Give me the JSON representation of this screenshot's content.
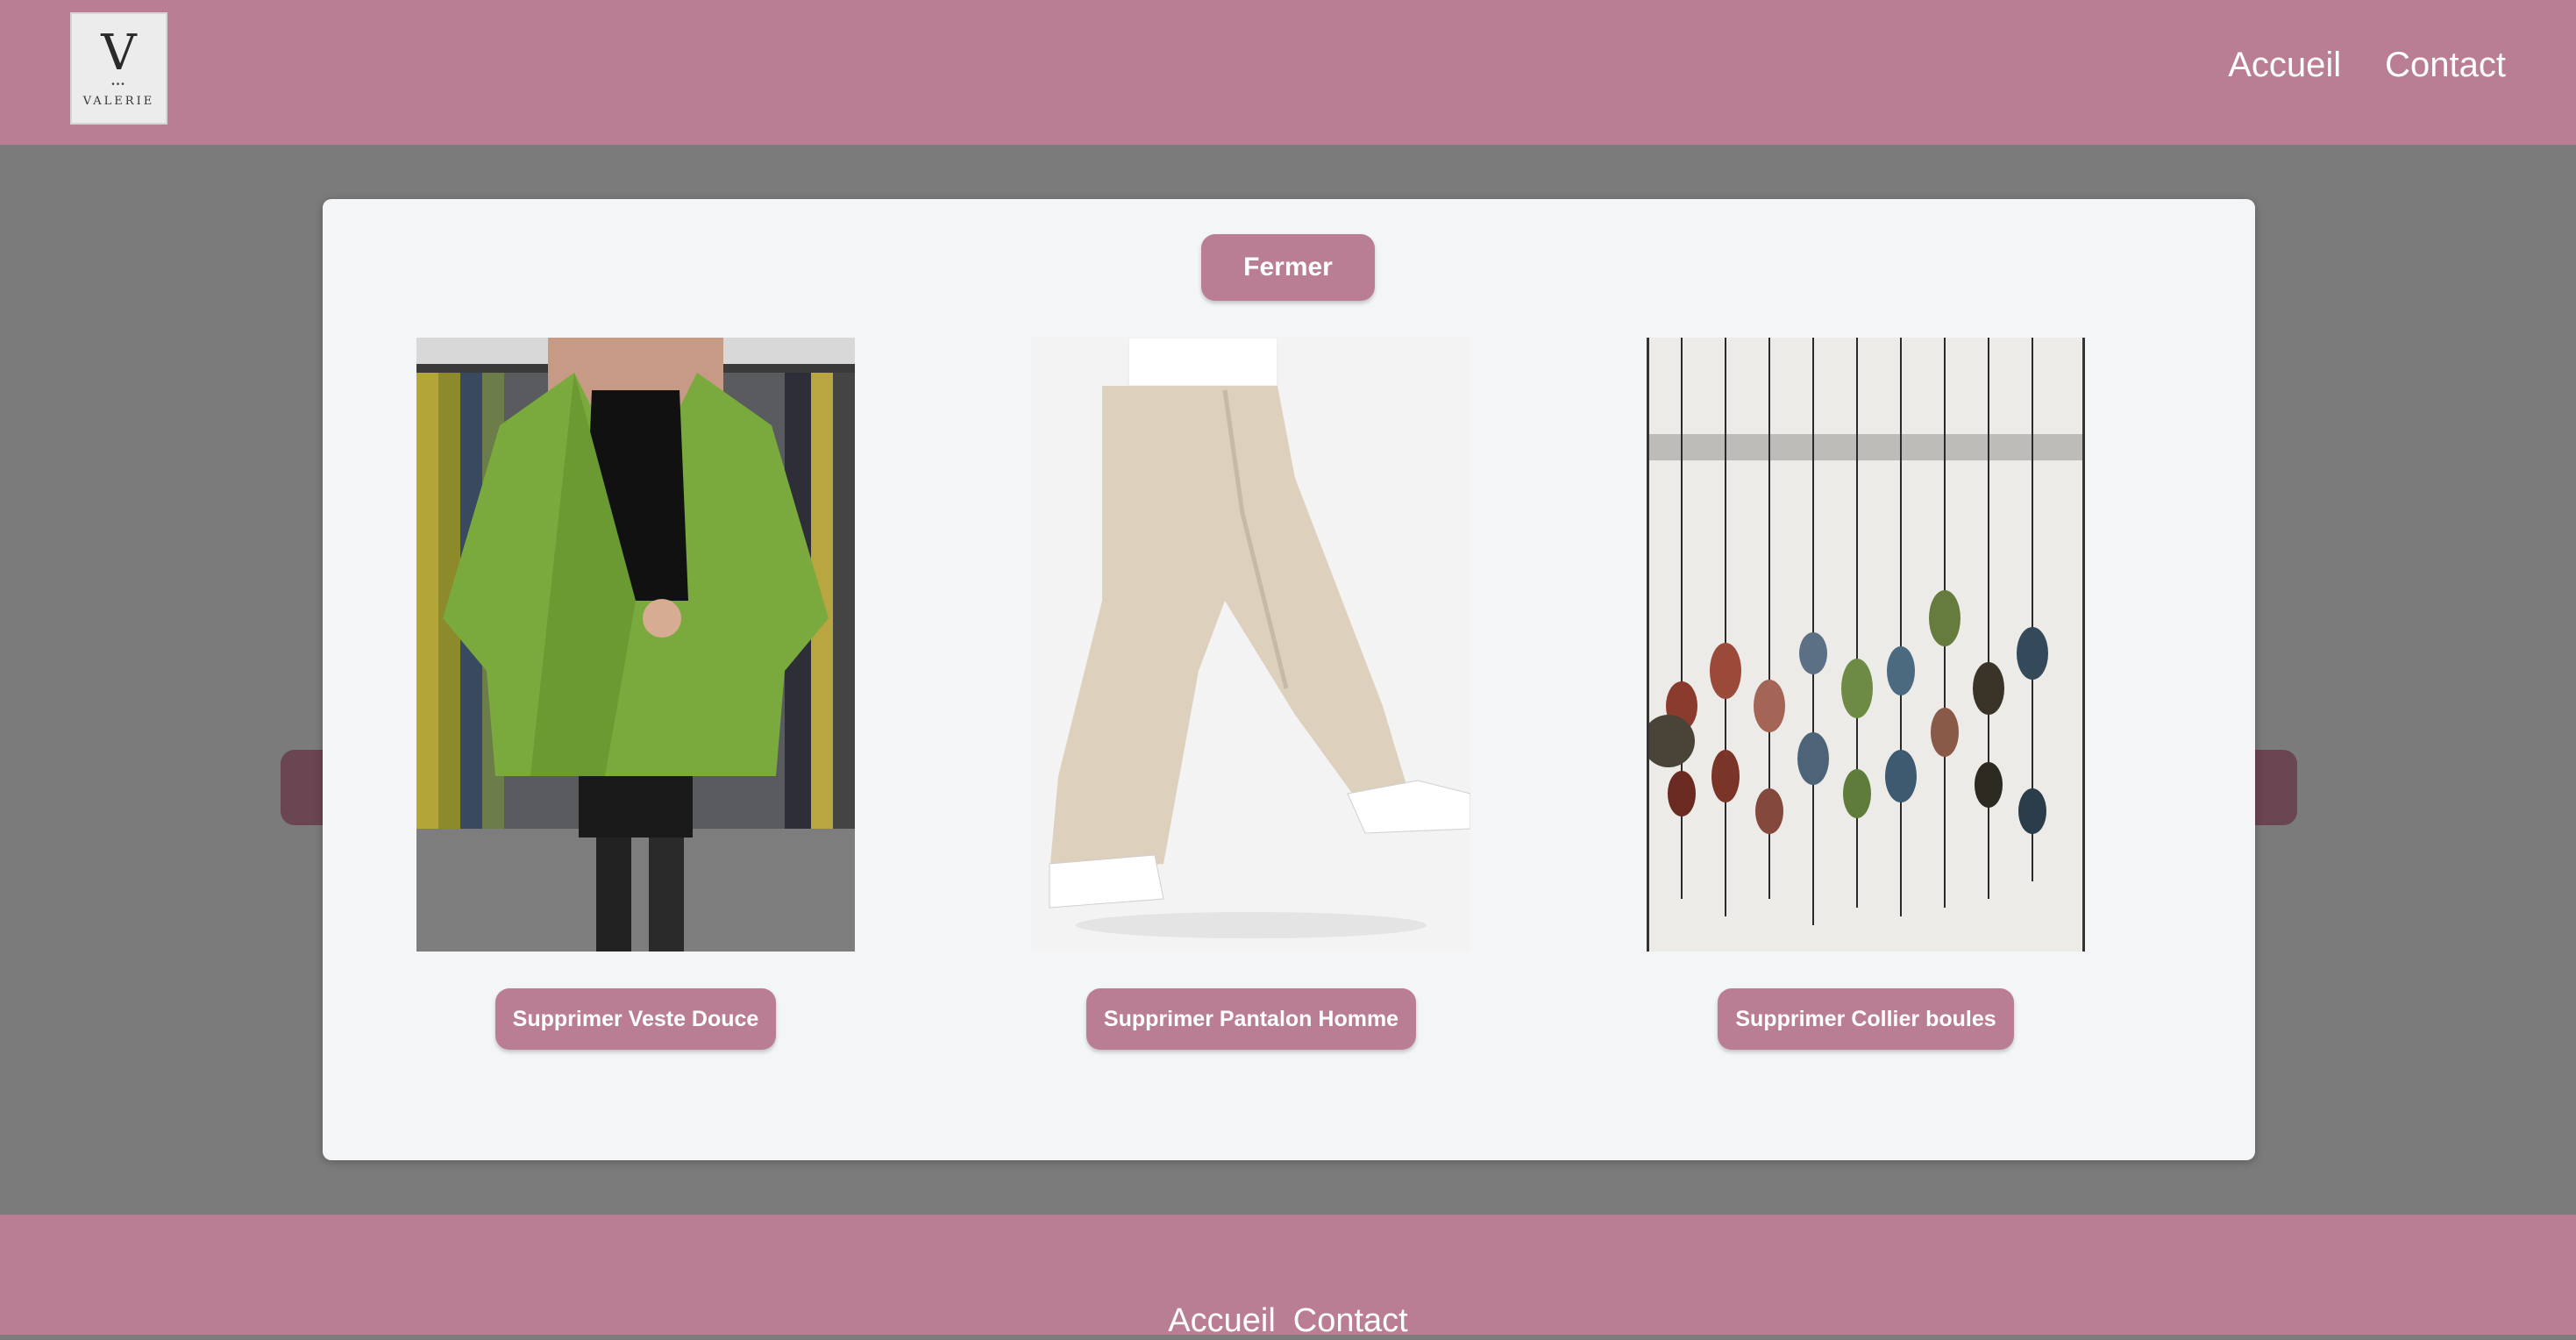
{
  "header": {
    "logo": {
      "letter": "V",
      "dots": "•••",
      "name": "VALERIE"
    },
    "nav": [
      {
        "label": "Accueil"
      },
      {
        "label": "Contact"
      }
    ]
  },
  "modal": {
    "close_label": "Fermer",
    "products": [
      {
        "name": "Veste Douce",
        "delete_label": "Supprimer Veste Douce",
        "image": "green-cardigan-photo"
      },
      {
        "name": "Pantalon Homme",
        "delete_label": "Supprimer Pantalon Homme",
        "image": "beige-trousers-photo"
      },
      {
        "name": "Collier boules",
        "delete_label": "Supprimer Collier boules",
        "image": "bead-necklaces-photo"
      }
    ]
  },
  "footer": {
    "nav": [
      {
        "label": "Accueil"
      },
      {
        "label": "Contact"
      }
    ]
  },
  "colors": {
    "brand": "#b97e93",
    "overlay": "#7b7b7b",
    "modal_bg": "#f3f5f7"
  }
}
